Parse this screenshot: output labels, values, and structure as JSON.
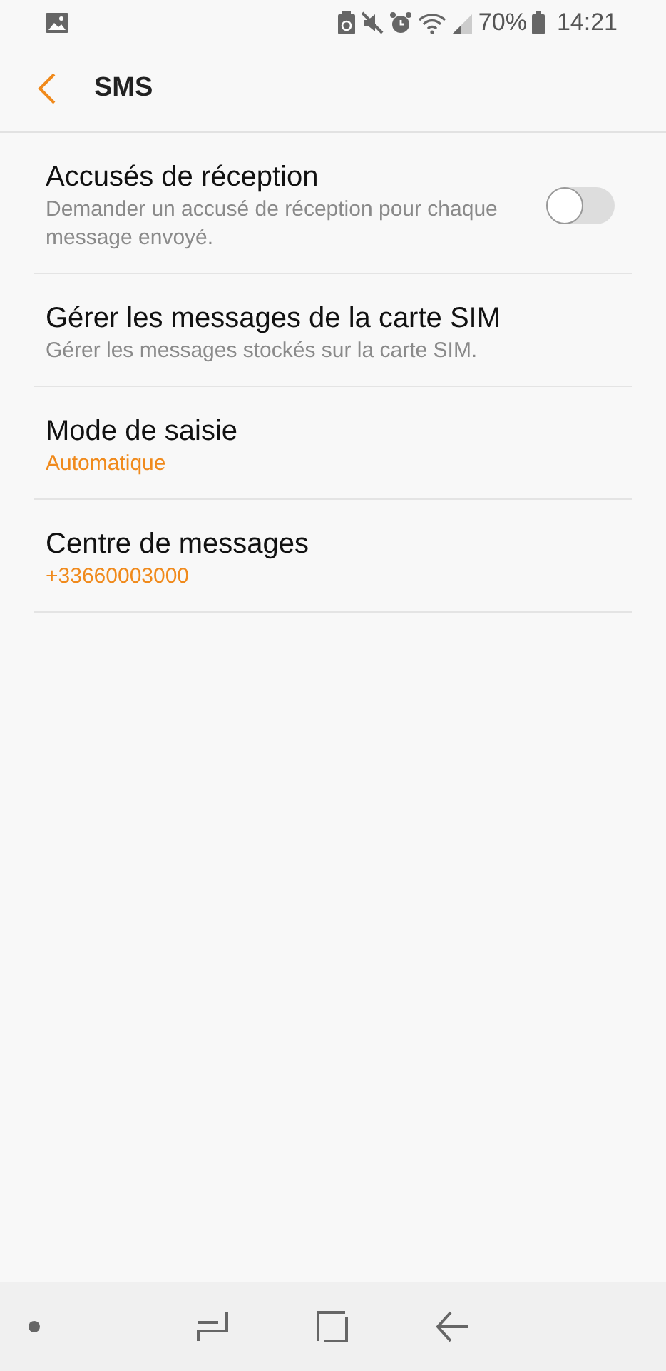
{
  "status_bar": {
    "battery_percent": "70%",
    "time": "14:21"
  },
  "header": {
    "title": "SMS"
  },
  "settings": [
    {
      "kind": "switch",
      "title": "Accusés de réception",
      "subtitle": "Demander un accusé de réception pour chaque message envoyé.",
      "on": false
    },
    {
      "kind": "description",
      "title": "Gérer les messages de la carte SIM",
      "subtitle": "Gérer les messages stockés sur la carte SIM."
    },
    {
      "kind": "value",
      "title": "Mode de saisie",
      "subtitle": "Automatique"
    },
    {
      "kind": "value",
      "title": "Centre de messages",
      "subtitle": "+33660003000"
    }
  ]
}
